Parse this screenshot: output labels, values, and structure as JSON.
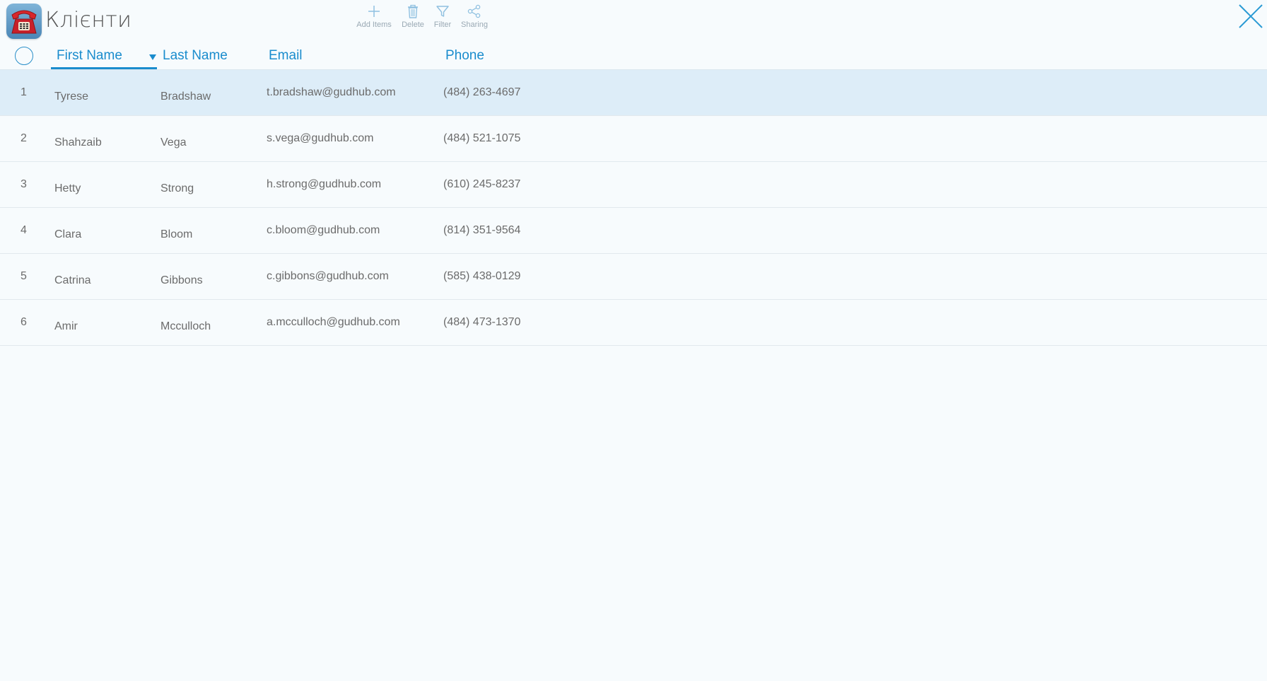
{
  "app": {
    "title": "Клієнти",
    "logo_icon": "red-telephone-icon",
    "accent_color": "#1a8ccd",
    "selected_row_color": "#ddedf8"
  },
  "toolbar": {
    "add_label": "Add Items",
    "delete_label": "Delete",
    "filter_label": "Filter",
    "sharing_label": "Sharing"
  },
  "table": {
    "columns": [
      {
        "label": "First Name",
        "active": true
      },
      {
        "label": "Last Name",
        "sort": "descending"
      },
      {
        "label": "Email"
      },
      {
        "label": "Phone"
      }
    ],
    "rows": [
      {
        "num": "1",
        "first": "Tyrese",
        "last": "Bradshaw",
        "email": "t.bradshaw@gudhub.com",
        "phone": "(484) 263-4697",
        "selected": true
      },
      {
        "num": "2",
        "first": "Shahzaib",
        "last": "Vega",
        "email": "s.vega@gudhub.com",
        "phone": "(484) 521-1075"
      },
      {
        "num": "3",
        "first": "Hetty",
        "last": "Strong",
        "email": "h.strong@gudhub.com",
        "phone": "(610) 245-8237"
      },
      {
        "num": "4",
        "first": "Clara",
        "last": "Bloom",
        "email": "c.bloom@gudhub.com",
        "phone": "(814) 351-9564"
      },
      {
        "num": "5",
        "first": "Catrina",
        "last": "Gibbons",
        "email": "c.gibbons@gudhub.com",
        "phone": "(585) 438-0129"
      },
      {
        "num": "6",
        "first": "Amir",
        "last": "Mcculloch",
        "email": "a.mcculloch@gudhub.com",
        "phone": "(484) 473-1370"
      }
    ]
  }
}
